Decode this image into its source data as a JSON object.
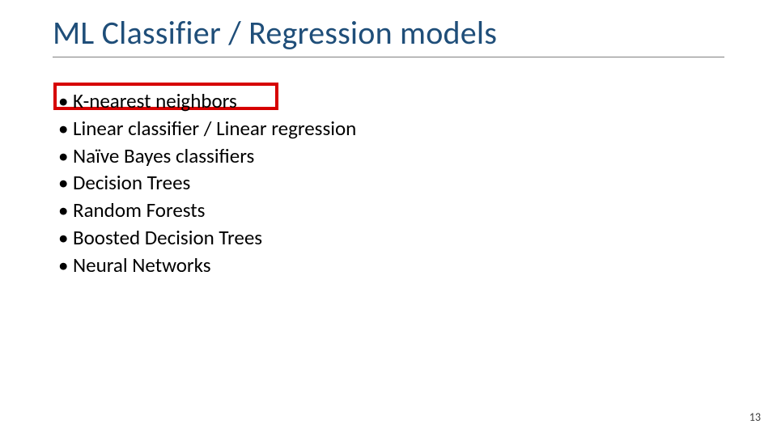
{
  "title": "ML Classifier / Regression models",
  "bullets": [
    "K-nearest neighbors",
    "Linear classifier / Linear regression",
    "Naïve Bayes classifiers",
    "Decision Trees",
    "Random Forests",
    "Boosted Decision Trees",
    "Neural Networks"
  ],
  "page_number": "13",
  "highlighted_index": 0
}
